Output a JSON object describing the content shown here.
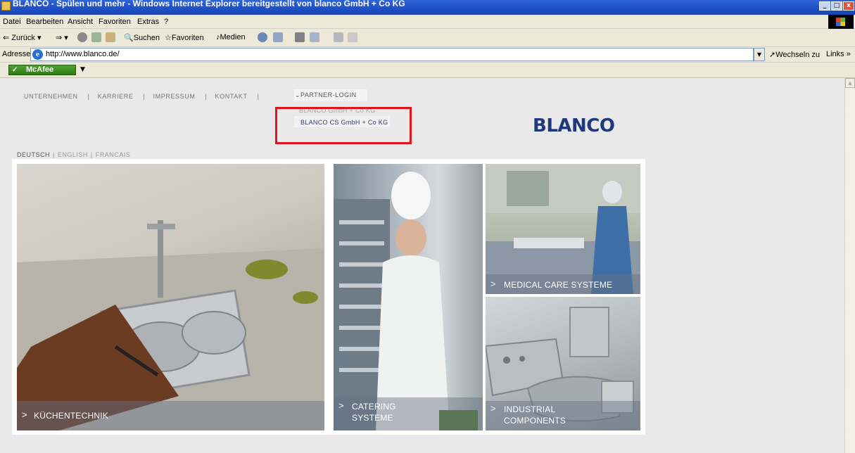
{
  "window": {
    "title": "BLANCO - Spülen und mehr - Windows Internet Explorer bereitgestellt von blanco GmbH + Co KG"
  },
  "menubar": {
    "items": [
      "Datei",
      "Bearbeiten",
      "Ansicht",
      "Favoriten",
      "Extras",
      "?"
    ]
  },
  "toolbar": {
    "back_label": "Zurück",
    "search_label": "Suchen",
    "favorites_label": "Favoriten",
    "media_label": "Medien"
  },
  "addressbar": {
    "label": "Adresse",
    "url": "http://www.blanco.de/",
    "go_label": "Wechseln zu",
    "links_label": "Links »"
  },
  "mcafee": {
    "label": "McAfee"
  },
  "page": {
    "nav": [
      "UNTERNEHMEN",
      "KARRIERE",
      "IMPRESSUM",
      "KONTAKT"
    ],
    "partner_login": "PARTNER-LOGIN",
    "partner_submenu": [
      "BLANCO GmbH + Co KG",
      "BLANCO CS GmbH + Co KG"
    ],
    "logo_text": "BLANCO",
    "languages": [
      "DEUTSCH",
      "ENGLISH",
      "FRANCAIS"
    ],
    "tiles": [
      {
        "line1": "KÜCHENTECHNIK",
        "line2": ""
      },
      {
        "line1": "CATERING",
        "line2": "SYSTEME"
      },
      {
        "line1": "MEDICAL CARE SYSTEME",
        "line2": ""
      },
      {
        "line1": "INDUSTRIAL",
        "line2": "COMPONENTS"
      }
    ]
  },
  "colors": {
    "highlight_box": "#e0121b",
    "logo": "#1e3a7c",
    "titlebar": "#1f4fc4"
  }
}
